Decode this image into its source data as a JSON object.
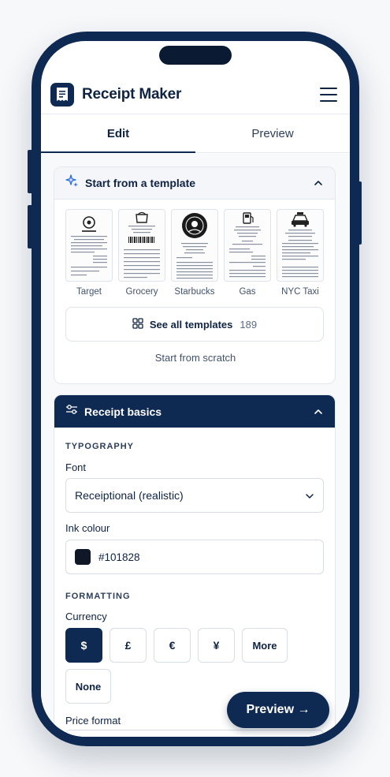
{
  "app": {
    "title": "Receipt Maker"
  },
  "tabs": [
    {
      "label": "Edit",
      "active": true
    },
    {
      "label": "Preview",
      "active": false
    }
  ],
  "template_section": {
    "title": "Start from a template",
    "templates": [
      {
        "label": "Target"
      },
      {
        "label": "Grocery"
      },
      {
        "label": "Starbucks"
      },
      {
        "label": "Gas"
      },
      {
        "label": "NYC Taxi"
      }
    ],
    "see_all_label": "See all templates",
    "see_all_count": "189",
    "scratch_label": "Start from scratch"
  },
  "basics_section": {
    "title": "Receipt basics",
    "typography_label": "TYPOGRAPHY",
    "font_label": "Font",
    "font_value": "Receiptional (realistic)",
    "ink_label": "Ink colour",
    "ink_value": "#101828",
    "formatting_label": "FORMATTING",
    "currency_label": "Currency",
    "currencies": [
      {
        "label": "$",
        "active": true
      },
      {
        "label": "£",
        "active": false
      },
      {
        "label": "€",
        "active": false
      },
      {
        "label": "¥",
        "active": false
      },
      {
        "label": "More",
        "active": false
      }
    ],
    "currency_none": "None",
    "price_format_label": "Price format"
  },
  "fab": {
    "label": "Preview →"
  },
  "colors": {
    "accent": "#0f2a52",
    "ink": "#101828",
    "background": "#f8f9fb"
  }
}
